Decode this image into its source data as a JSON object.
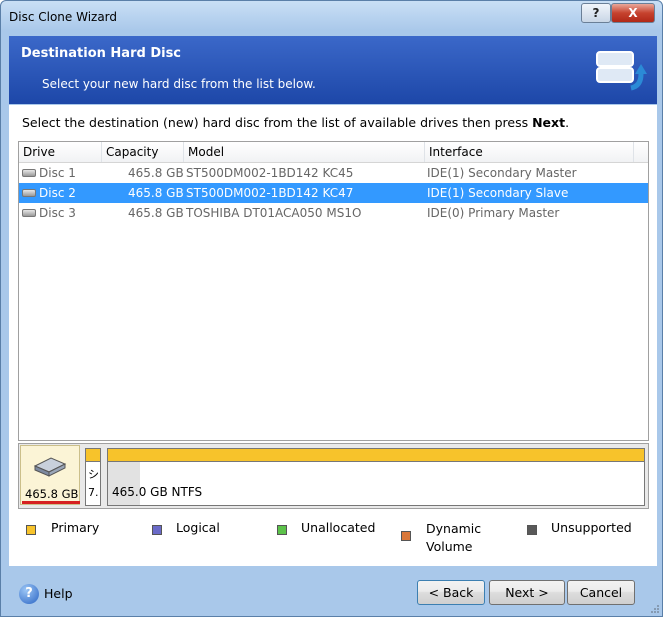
{
  "window": {
    "title": "Disc Clone Wizard",
    "help_btn": "?",
    "close_btn": "X"
  },
  "header": {
    "title": "Destination Hard Disc",
    "subtitle": "Select your new hard disc from the list below."
  },
  "instruction": {
    "text": "Select the destination (new) hard disc from the list of available drives then press ",
    "bold": "Next",
    "end": "."
  },
  "table": {
    "columns": [
      "Drive",
      "Capacity",
      "Model",
      "Interface"
    ],
    "rows": [
      {
        "drive": "Disc 1",
        "capacity": "465.8 GB",
        "model": "ST500DM002-1BD142 KC45",
        "interface": "IDE(1) Secondary Master",
        "selected": false
      },
      {
        "drive": "Disc 2",
        "capacity": "465.8 GB",
        "model": "ST500DM002-1BD142 KC47",
        "interface": "IDE(1) Secondary Slave",
        "selected": true
      },
      {
        "drive": "Disc 3",
        "capacity": "465.8 GB",
        "model": "TOSHIBA DT01ACA050 MS1O",
        "interface": "IDE(0) Primary Master",
        "selected": false
      }
    ]
  },
  "diskmap": {
    "disk_size": "465.8 GB",
    "small_partition": {
      "line1": "シ",
      "line2": "7."
    },
    "main_partition": {
      "label": "465.0 GB  NTFS"
    }
  },
  "legend": [
    {
      "label": "Primary",
      "color": "#f7c32b"
    },
    {
      "label": "Logical",
      "color": "#6a6ac8"
    },
    {
      "label": "Unallocated",
      "color": "#5cc24a"
    },
    {
      "label": "Dynamic\nVolume",
      "color": "#d9773a"
    },
    {
      "label": "Unsupported",
      "color": "#595959"
    }
  ],
  "footer": {
    "help": "Help",
    "back": "< Back",
    "next": "Next >",
    "cancel": "Cancel"
  }
}
